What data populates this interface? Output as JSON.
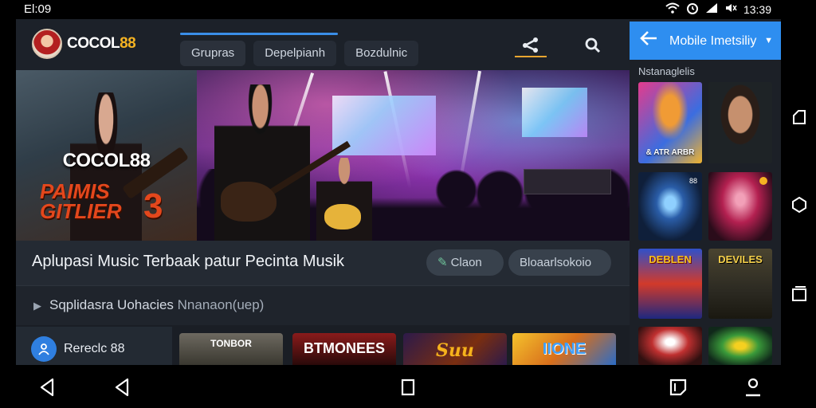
{
  "status_bar": {
    "time": "El:09",
    "right_time": "13:39",
    "icons": [
      "wifi-icon",
      "alarm-icon",
      "signal-icon",
      "mute-icon"
    ]
  },
  "app": {
    "logo": {
      "brand_white": "COCOL",
      "brand_gold": "88"
    },
    "tabs": [
      {
        "label": "Grupras",
        "active": true
      },
      {
        "label": "Depelpianh",
        "active": false
      },
      {
        "label": "Bozdulnic",
        "active": false
      }
    ],
    "tab_progress": 1.0,
    "nav_icons": [
      "share-icon",
      "search-icon"
    ],
    "hero": {
      "poster_title": "COCOL88",
      "poster_sub_line1": "PAIMIS",
      "poster_sub_line2": "GITLIER",
      "poster_number": "3"
    },
    "info": {
      "headline": "Aplupasi Music Terbaak patur Pecinta Musik",
      "pill1": "Claon",
      "pill2": "Bloaarlsokoio"
    },
    "subtitle": {
      "text": "Sqplidasra Uohacies",
      "text2": "Nnanaon(uep)"
    },
    "user": {
      "icon": "user-icon",
      "name": "Rereclc 88"
    },
    "thumbnails": [
      {
        "title": "TONBOR"
      },
      {
        "title": "BTMONEES"
      },
      {
        "title": "Suu DoPlig"
      },
      {
        "title": "IIONE"
      }
    ]
  },
  "right_panel": {
    "header_title": "Mobile Imetsiliy",
    "section_title": "Nstanaglelis",
    "cards": [
      {
        "text": "& ATR ARBR"
      },
      {
        "text": ""
      },
      {
        "text": ""
      },
      {
        "text": ""
      },
      {
        "title": "DEBLEN"
      },
      {
        "title": "DEVILES"
      }
    ],
    "card3_tag": "88"
  },
  "system_nav": {
    "right": [
      "recent-apps-icon",
      "home-icon",
      "overview-icon"
    ],
    "bottom": [
      "back-icon",
      "back-icon-2",
      "square-icon",
      "notes-icon",
      "profile-icon"
    ]
  },
  "colors": {
    "accent_blue": "#2e8ef0",
    "brand_gold": "#f5b322",
    "poster_red": "#e4471c"
  }
}
